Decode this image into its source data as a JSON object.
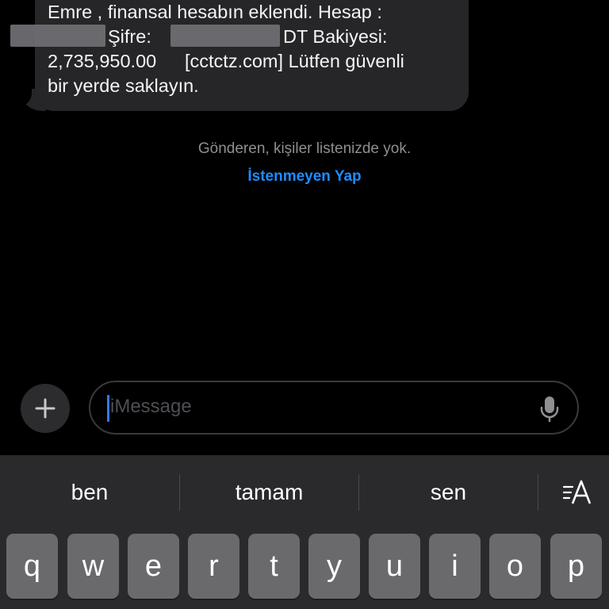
{
  "message": {
    "lines": [
      "Emre , finansal hesabın eklendi. Hesap :",
      "Şifre:",
      "DT Bakiyesi:",
      "2,735,950.00",
      "[cctctz.com] Lütfen güvenli",
      "bir yerde saklayın."
    ]
  },
  "notice": {
    "text": "Gönderen, kişiler listenizde yok.",
    "action": "İstenmeyen Yap"
  },
  "compose": {
    "placeholder": "iMessage",
    "add_icon": "plus-icon",
    "mic_icon": "microphone-icon"
  },
  "keyboard": {
    "suggestions": [
      "ben",
      "tamam",
      "sen"
    ],
    "format_icon": "text-format-icon",
    "keys": [
      "q",
      "w",
      "e",
      "r",
      "t",
      "y",
      "u",
      "i",
      "o",
      "p"
    ]
  },
  "colors": {
    "background": "#000000",
    "bubble": "#262629",
    "link": "#1e8cff",
    "keyboard": "#2a2a2c",
    "key": "#6a6a6d",
    "caret": "#3478f6"
  }
}
